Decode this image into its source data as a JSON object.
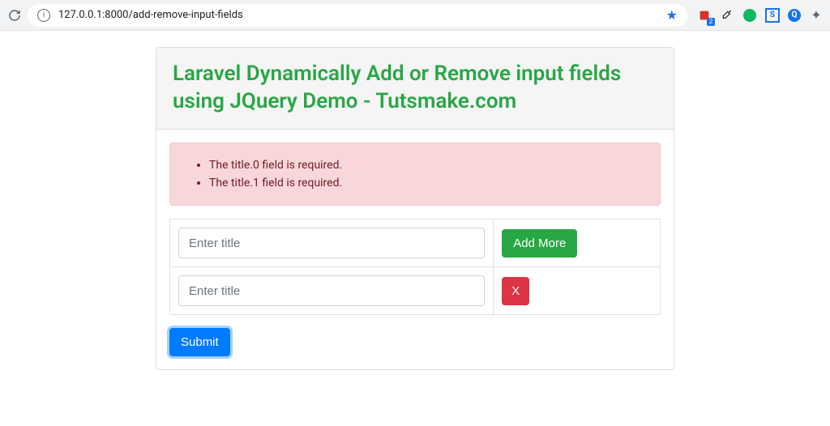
{
  "browser": {
    "url": "127.0.0.1:8000/add-remove-input-fields",
    "extBadge": "2",
    "extS": "S",
    "extQ": "Q"
  },
  "header": {
    "title": "Laravel Dynamically Add or Remove input fields using JQuery Demo - Tutsmake.com"
  },
  "alert": {
    "errors": [
      "The title.0 field is required.",
      "The title.1 field is required."
    ]
  },
  "form": {
    "rows": [
      {
        "placeholder": "Enter title",
        "value": "",
        "actionLabel": "Add More",
        "actionType": "add"
      },
      {
        "placeholder": "Enter title",
        "value": "",
        "actionLabel": "X",
        "actionType": "remove"
      }
    ],
    "submitLabel": "Submit"
  }
}
